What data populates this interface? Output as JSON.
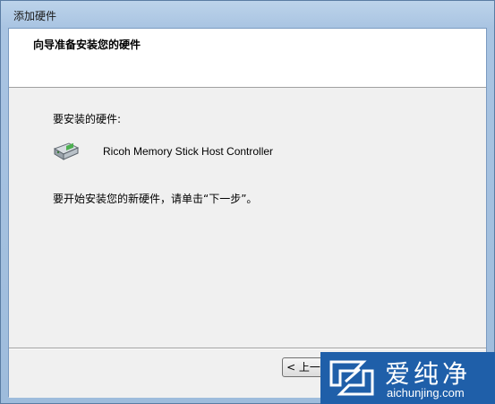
{
  "window": {
    "title": "添加硬件"
  },
  "header": {
    "title": "向导准备安装您的硬件"
  },
  "content": {
    "prompt_label": "要安装的硬件:",
    "device_name": "Ricoh Memory Stick Host Controller",
    "device_icon": "memory-stick-device-icon",
    "instruction": "要开始安装您的新硬件，请单击“下一步”。"
  },
  "footer": {
    "back_label": "< 上一步"
  },
  "watermark": {
    "brand": "爱纯净",
    "url": "aichunjing.com",
    "color": "#1f5fa9"
  }
}
